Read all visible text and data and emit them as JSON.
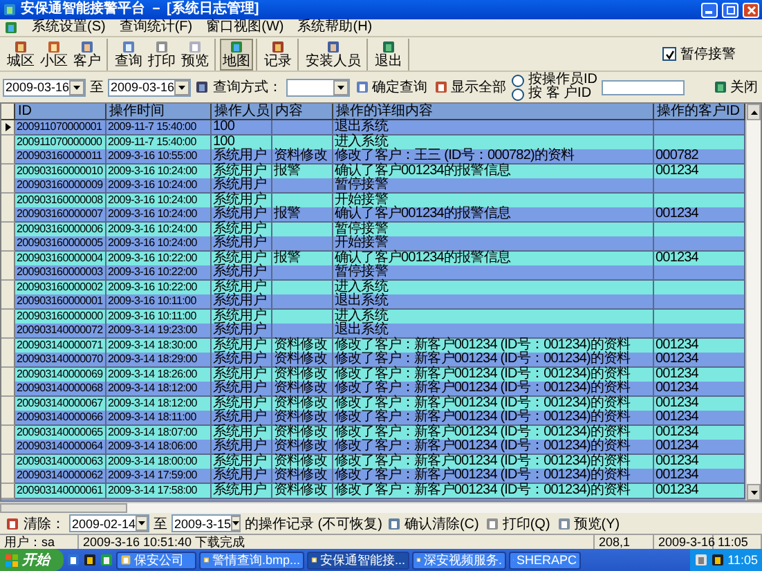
{
  "window": {
    "title": "安保通智能接警平台 － [系统日志管理]"
  },
  "menu": [
    "系统设置(S)",
    "查询统计(F)",
    "窗口视图(W)",
    "系统帮助(H)"
  ],
  "toolbar": {
    "groups": [
      [
        {
          "label": "城区",
          "pressed": false
        },
        {
          "label": "小区",
          "pressed": false
        },
        {
          "label": "客户",
          "pressed": false
        }
      ],
      [
        {
          "label": "查询",
          "pressed": false
        },
        {
          "label": "打印",
          "pressed": false
        },
        {
          "label": "预览",
          "pressed": false
        }
      ],
      [
        {
          "label": "地图",
          "pressed": true
        }
      ],
      [
        {
          "label": "记录",
          "pressed": false
        }
      ],
      [
        {
          "label": "安装人员",
          "pressed": false
        }
      ],
      [
        {
          "label": "退出",
          "pressed": false
        }
      ]
    ],
    "pause_alarm": {
      "label": "暂停接警",
      "checked": true
    }
  },
  "query": {
    "from": "2009-03-16",
    "to_label": "至",
    "to": "2009-03-16",
    "mode_label": "查询方式：",
    "confirm": "确定查询",
    "show_all": "显示全部",
    "radios": [
      {
        "label": "按操作员ID",
        "selected": false
      },
      {
        "label": "按 客 户ID",
        "selected": false
      }
    ],
    "close": "关闭"
  },
  "table": {
    "columns": [
      "ID",
      "操作时间",
      "操作人员",
      "内容",
      "操作的详细内容",
      "操作的客户ID"
    ],
    "rows": [
      {
        "current": true,
        "cells": [
          "200911070000001",
          "2009-11-7 15:40:00",
          "100",
          "",
          "退出系统",
          ""
        ]
      },
      {
        "current": false,
        "cells": [
          "200911070000000",
          "2009-11-7 15:40:00",
          "100",
          "",
          "进入系统",
          ""
        ]
      },
      {
        "current": false,
        "cells": [
          "200903160000011",
          "2009-3-16 10:55:00",
          "系统用户",
          "资料修改",
          "修改了客户：王三 (ID号：000782)的资料",
          "000782"
        ]
      },
      {
        "current": false,
        "cells": [
          "200903160000010",
          "2009-3-16 10:24:00",
          "系统用户",
          "报警",
          "确认了客户001234的报警信息",
          "001234"
        ]
      },
      {
        "current": false,
        "cells": [
          "200903160000009",
          "2009-3-16 10:24:00",
          "系统用户",
          "",
          "暂停接警",
          ""
        ]
      },
      {
        "current": false,
        "cells": [
          "200903160000008",
          "2009-3-16 10:24:00",
          "系统用户",
          "",
          "开始接警",
          ""
        ]
      },
      {
        "current": false,
        "cells": [
          "200903160000007",
          "2009-3-16 10:24:00",
          "系统用户",
          "报警",
          "确认了客户001234的报警信息",
          "001234"
        ]
      },
      {
        "current": false,
        "cells": [
          "200903160000006",
          "2009-3-16 10:24:00",
          "系统用户",
          "",
          "暂停接警",
          ""
        ]
      },
      {
        "current": false,
        "cells": [
          "200903160000005",
          "2009-3-16 10:24:00",
          "系统用户",
          "",
          "开始接警",
          ""
        ]
      },
      {
        "current": false,
        "cells": [
          "200903160000004",
          "2009-3-16 10:22:00",
          "系统用户",
          "报警",
          "确认了客户001234的报警信息",
          "001234"
        ]
      },
      {
        "current": false,
        "cells": [
          "200903160000003",
          "2009-3-16 10:22:00",
          "系统用户",
          "",
          "暂停接警",
          ""
        ]
      },
      {
        "current": false,
        "cells": [
          "200903160000002",
          "2009-3-16 10:22:00",
          "系统用户",
          "",
          "进入系统",
          ""
        ]
      },
      {
        "current": false,
        "cells": [
          "200903160000001",
          "2009-3-16 10:11:00",
          "系统用户",
          "",
          "退出系统",
          ""
        ]
      },
      {
        "current": false,
        "cells": [
          "200903160000000",
          "2009-3-16 10:11:00",
          "系统用户",
          "",
          "进入系统",
          ""
        ]
      },
      {
        "current": false,
        "cells": [
          "200903140000072",
          "2009-3-14 19:23:00",
          "系统用户",
          "",
          "退出系统",
          ""
        ]
      },
      {
        "current": false,
        "cells": [
          "200903140000071",
          "2009-3-14 18:30:00",
          "系统用户",
          "资料修改",
          "修改了客户：新客户001234 (ID号：001234)的资料",
          "001234"
        ]
      },
      {
        "current": false,
        "cells": [
          "200903140000070",
          "2009-3-14 18:29:00",
          "系统用户",
          "资料修改",
          "修改了客户：新客户001234 (ID号：001234)的资料",
          "001234"
        ]
      },
      {
        "current": false,
        "cells": [
          "200903140000069",
          "2009-3-14 18:26:00",
          "系统用户",
          "资料修改",
          "修改了客户：新客户001234 (ID号：001234)的资料",
          "001234"
        ]
      },
      {
        "current": false,
        "cells": [
          "200903140000068",
          "2009-3-14 18:12:00",
          "系统用户",
          "资料修改",
          "修改了客户：新客户001234 (ID号：001234)的资料",
          "001234"
        ]
      },
      {
        "current": false,
        "cells": [
          "200903140000067",
          "2009-3-14 18:12:00",
          "系统用户",
          "资料修改",
          "修改了客户：新客户001234 (ID号：001234)的资料",
          "001234"
        ]
      },
      {
        "current": false,
        "cells": [
          "200903140000066",
          "2009-3-14 18:11:00",
          "系统用户",
          "资料修改",
          "修改了客户：新客户001234 (ID号：001234)的资料",
          "001234"
        ]
      },
      {
        "current": false,
        "cells": [
          "200903140000065",
          "2009-3-14 18:07:00",
          "系统用户",
          "资料修改",
          "修改了客户：新客户001234 (ID号：001234)的资料",
          "001234"
        ]
      },
      {
        "current": false,
        "cells": [
          "200903140000064",
          "2009-3-14 18:06:00",
          "系统用户",
          "资料修改",
          "修改了客户：新客户001234 (ID号：001234)的资料",
          "001234"
        ]
      },
      {
        "current": false,
        "cells": [
          "200903140000063",
          "2009-3-14 18:00:00",
          "系统用户",
          "资料修改",
          "修改了客户：新客户001234 (ID号：001234)的资料",
          "001234"
        ]
      },
      {
        "current": false,
        "cells": [
          "200903140000062",
          "2009-3-14 17:59:00",
          "系统用户",
          "资料修改",
          "修改了客户：新客户001234 (ID号：001234)的资料",
          "001234"
        ]
      },
      {
        "current": false,
        "cells": [
          "200903140000061",
          "2009-3-14 17:58:00",
          "系统用户",
          "资料修改",
          "修改了客户：新客户001234 (ID号：001234)的资料",
          "001234"
        ]
      }
    ]
  },
  "clear_bar": {
    "label": "清除：",
    "from": "2009-02-14",
    "to_label": "至",
    "to": "2009-3-15",
    "note": "的操作记录 (不可恢复)",
    "confirm": "确认清除(C)",
    "print": "打印(Q)",
    "preview": "预览(Y)"
  },
  "status_bar": [
    "用户：sa",
    "2009-3-16 10:51:40 下载完成",
    "208,1",
    "2009-3-16",
    "11:05"
  ],
  "taskbar": {
    "start": "开始",
    "tasks": [
      {
        "label": "保安公司",
        "active": false
      },
      {
        "label": "警情查询.bmp...",
        "active": false
      },
      {
        "label": "安保通智能接...",
        "active": true
      },
      {
        "label": "深安视频服务.",
        "active": false
      },
      {
        "label": "SHERAPC",
        "active": false
      }
    ],
    "clock": "11:05"
  }
}
